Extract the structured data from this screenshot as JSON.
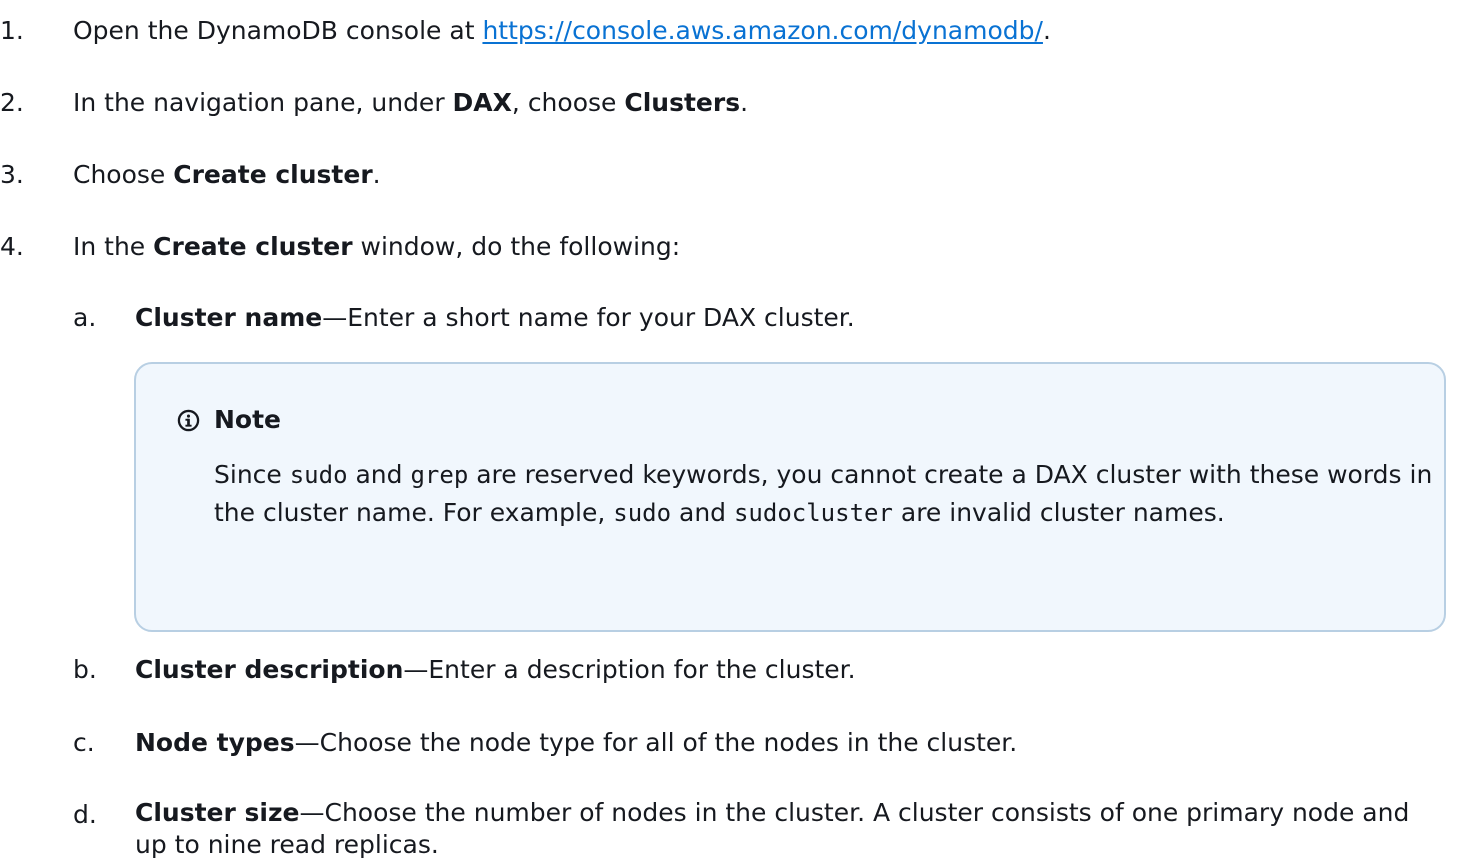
{
  "steps": [
    {
      "number": "1.",
      "prefix": "Open the DynamoDB console at ",
      "link": "https://console.aws.amazon.com/dynamodb/",
      "suffix": "."
    },
    {
      "number": "2.",
      "prefix": "In the navigation pane, under ",
      "bold1": "DAX",
      "middle": ", choose ",
      "bold2": "Clusters",
      "suffix": "."
    },
    {
      "number": "3.",
      "prefix": "Choose ",
      "bold": "Create cluster",
      "suffix": "."
    },
    {
      "number": "4.",
      "prefix": "In the ",
      "bold": "Create cluster",
      "suffix": " window, do the following:"
    }
  ],
  "substeps": [
    {
      "letter": "a.",
      "title": "Cluster name",
      "text": "—Enter a short name for your DAX cluster."
    },
    {
      "letter": "b.",
      "title": "Cluster description",
      "text": "—Enter a description for the cluster."
    },
    {
      "letter": "c.",
      "title": "Node types",
      "text": "—Choose the node type for all of the nodes in the cluster."
    },
    {
      "letter": "d.",
      "title": "Cluster size",
      "text": "—Choose the number of nodes in the cluster. A cluster consists of one primary node and up to nine read replicas."
    }
  ],
  "note": {
    "title": "Note",
    "icon": "info-icon",
    "t1": "Since ",
    "c1": "sudo",
    "t2": " and ",
    "c2": "grep",
    "t3": " are reserved keywords, you cannot create a DAX cluster with these words in the cluster name. For example, ",
    "c3": "sudo",
    "t4": " and ",
    "c4": "sudocluster",
    "t5": " are invalid cluster names."
  },
  "colors": {
    "link": "#0972d3",
    "note_background": "#f1f7fd",
    "note_border": "#b8cfe3",
    "text": "#16191f"
  }
}
